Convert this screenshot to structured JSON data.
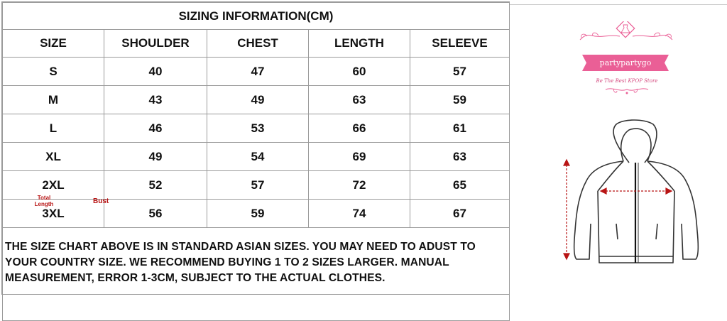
{
  "table": {
    "title": "SIZING INFORMATION(CM)",
    "headers": [
      "SIZE",
      "SHOULDER",
      "CHEST",
      "LENGTH",
      "SELEEVE"
    ],
    "rows": [
      [
        "S",
        "40",
        "47",
        "60",
        "57"
      ],
      [
        "M",
        "43",
        "49",
        "63",
        "59"
      ],
      [
        "L",
        "46",
        "53",
        "66",
        "61"
      ],
      [
        "XL",
        "49",
        "54",
        "69",
        "63"
      ],
      [
        "2XL",
        "52",
        "57",
        "72",
        "65"
      ],
      [
        "3XL",
        "56",
        "59",
        "74",
        "67"
      ]
    ],
    "note": "THE SIZE CHART ABOVE IS IN STANDARD ASIAN SIZES. YOU MAY NEED TO ADUST TO YOUR COUNTRY SIZE. WE RECOMMEND BUYING 1 TO 2 SIZES LARGER. MANUAL MEASUREMENT, ERROR 1-3CM, SUBJECT TO THE ACTUAL CLOTHES."
  },
  "logo": {
    "name": "partypartygo",
    "tagline": "Be The Best KPOP Store",
    "accent": "#ea5f96"
  },
  "diagram": {
    "total_length_label": "Total Length",
    "bust_label": "Bust",
    "measure_color": "#b81414"
  }
}
